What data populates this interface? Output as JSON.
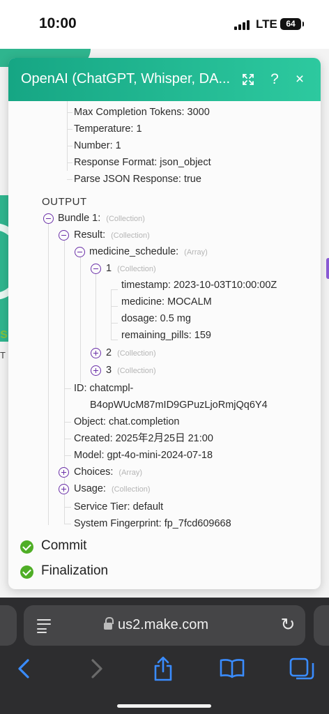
{
  "status": {
    "time": "10:00",
    "network": "LTE",
    "battery": "64"
  },
  "background": {
    "text1": "s",
    "text2": "T"
  },
  "modal": {
    "title": "OpenAI (ChatGPT, Whisper, DA...",
    "help_label": "?",
    "close_label": "×",
    "params": [
      {
        "key": "Max Completion Tokens:",
        "value": "3000"
      },
      {
        "key": "Temperature:",
        "value": "1"
      },
      {
        "key": "Number:",
        "value": "1"
      },
      {
        "key": "Response Format:",
        "value": "json_object"
      },
      {
        "key": "Parse JSON Response:",
        "value": "true"
      }
    ],
    "output_label": "OUTPUT",
    "bundle": {
      "key": "Bundle 1:",
      "type": "(Collection)"
    },
    "result": {
      "key": "Result:",
      "type": "(Collection)"
    },
    "schedule": {
      "key": "medicine_schedule:",
      "type": "(Array)"
    },
    "item1": {
      "key": "1",
      "type": "(Collection)",
      "fields": [
        {
          "key": "timestamp:",
          "value": "2023-10-03T10:00:00Z"
        },
        {
          "key": "medicine:",
          "value": "MOCALM"
        },
        {
          "key": "dosage:",
          "value": "0.5 mg"
        },
        {
          "key": "remaining_pills:",
          "value": "159"
        }
      ]
    },
    "item2": {
      "key": "2",
      "type": "(Collection)"
    },
    "item3": {
      "key": "3",
      "type": "(Collection)"
    },
    "id": {
      "key": "ID:",
      "value_line1": "chatcmpl-",
      "value_line2": "B4opWUcM87mID9GPuzLjoRmjQq6Y4"
    },
    "object": {
      "key": "Object:",
      "value": "chat.completion"
    },
    "created": {
      "key": "Created:",
      "value": "2025年2月25日 21:00"
    },
    "model": {
      "key": "Model:",
      "value": "gpt-4o-mini-2024-07-18"
    },
    "choices": {
      "key": "Choices:",
      "type": "(Array)"
    },
    "usage": {
      "key": "Usage:",
      "type": "(Collection)"
    },
    "service_tier": {
      "key": "Service Tier:",
      "value": "default"
    },
    "fingerprint": {
      "key": "System Fingerprint:",
      "value": "fp_7fcd609668"
    },
    "stages": [
      "Commit",
      "Finalization"
    ]
  },
  "browser": {
    "url": "us2.make.com"
  }
}
